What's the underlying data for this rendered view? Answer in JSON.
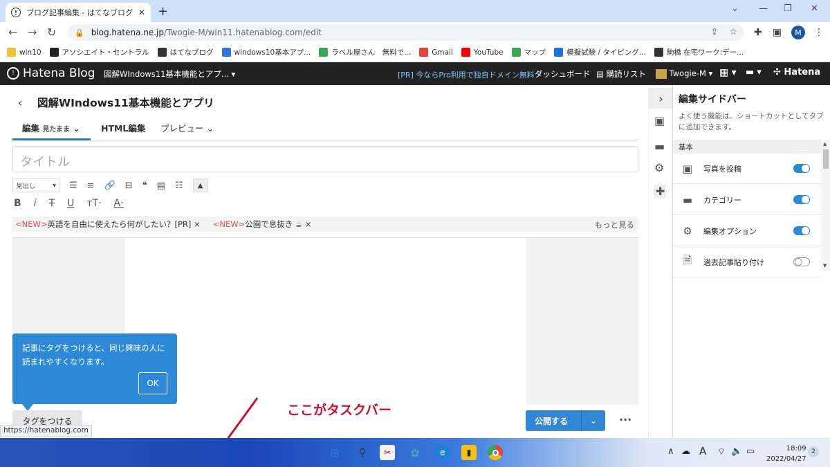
{
  "browser": {
    "tab_title": "ブログ記事編集 - はてなブログ",
    "url_host": "blog.hatena.ne.jp",
    "url_path": "/Twogie-M/win11.hatenablog.com/edit",
    "profile_initial": "M",
    "bookmarks": [
      {
        "label": "win10",
        "color": "#f1c232"
      },
      {
        "label": "アソシエイト・セントラル",
        "color": "#222222"
      },
      {
        "label": "はてなブログ",
        "color": "#333333"
      },
      {
        "label": "windows10基本アプ...",
        "color": "#2b78e4"
      },
      {
        "label": "ラベル屋さん　無料で...",
        "color": "#34a853"
      },
      {
        "label": "Gmail",
        "color": "#ea4335"
      },
      {
        "label": "YouTube",
        "color": "#ff0000"
      },
      {
        "label": "マップ",
        "color": "#34a853"
      },
      {
        "label": "模擬試験 / タイピング...",
        "color": "#1a73e8"
      },
      {
        "label": "駒橋 在宅ワーク:デー...",
        "color": "#333333"
      }
    ]
  },
  "hatena": {
    "logo": "Hatena Blog",
    "blog_select": "図解WIndows11基本機能とアプ...",
    "pr": "[PR] 今ならPro利用で独自ドメイン無料",
    "dashboard": "ダッシュボード",
    "reading_list": "購読リスト",
    "user": "Twogie-M",
    "brand": "Hatena"
  },
  "editor": {
    "blog_title": "図解WIndows11基本機能とアプリ",
    "mode_edit": "編集",
    "mode_edit_sub": "見たまま",
    "mode_html": "HTML編集",
    "mode_preview": "プレビュー",
    "title_placeholder": "タイトル",
    "heading_select": "見出し",
    "news": [
      {
        "tag": "<NEW>",
        "text": "英語を自由に使えたら何がしたい？[PR]"
      },
      {
        "tag": "<NEW>",
        "text": "公園で息抜き"
      }
    ],
    "more": "もっと見る",
    "tooltip": "記事にタグをつけると、同じ興味の人に読まれやすくなります。",
    "tooltip_ok": "OK",
    "tag_button": "タグをつける",
    "publish": "公開する",
    "status_url": "https://hatenablog.com",
    "annotation": "ここがタスクバー"
  },
  "sidebar": {
    "title": "編集サイドバー",
    "description": "よく使う機能は、ショートカットとしてタブに追加できます。",
    "section": "基本",
    "items": [
      {
        "label": "写真を投稿",
        "icon": "photo-icon",
        "enabled": true
      },
      {
        "label": "カテゴリー",
        "icon": "folder-icon",
        "enabled": true
      },
      {
        "label": "編集オプション",
        "icon": "gear-icon",
        "enabled": true
      },
      {
        "label": "過去記事貼り付け",
        "icon": "document-icon",
        "enabled": false
      }
    ]
  },
  "taskbar": {
    "time": "18:09",
    "date": "2022/04/27",
    "notifications": "2",
    "ime": "A"
  }
}
